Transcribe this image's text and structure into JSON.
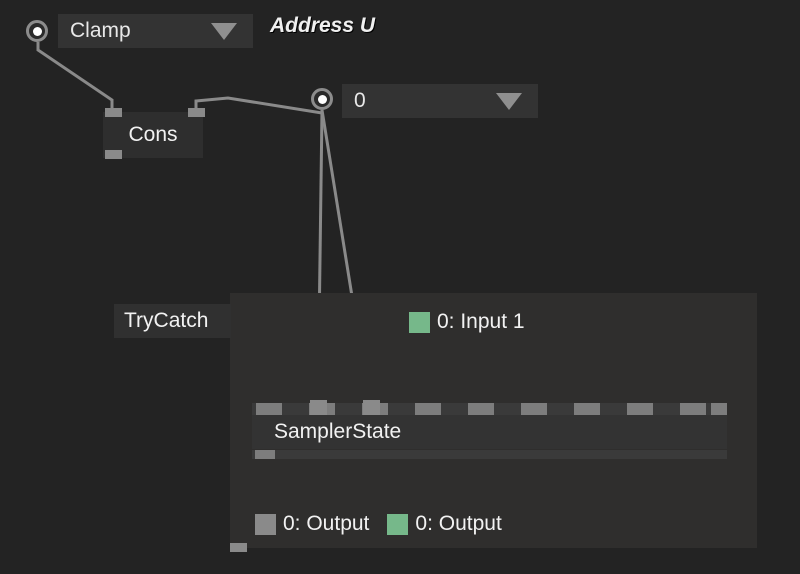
{
  "theme": {
    "background": "#232323",
    "panel": "#2f2e2d",
    "node": "#2e2e2e",
    "combo": "#333333",
    "wire": "#8a8a8a",
    "pin": "#8a8a8a",
    "text": "#f2f2f2",
    "port_green": "#76b88a",
    "port_gray": "#8a8a8a",
    "slot_bar": "#3a3a3a",
    "slot": "#7d7d7d"
  },
  "nodes": {
    "clamp_combo": {
      "value": "Clamp",
      "caret_icon": "chevron-down-icon",
      "radio_icon": "radio-pin-icon"
    },
    "address_u_label": "Address U",
    "index_combo": {
      "value": "0",
      "caret_icon": "chevron-down-icon",
      "radio_icon": "radio-pin-icon"
    },
    "cons_node": {
      "title": "Cons"
    },
    "trycatch_group": {
      "title": "TryCatch"
    },
    "sampler_state": {
      "title": "SamplerState",
      "slot_count": 11
    }
  },
  "ports": {
    "input_row": [
      {
        "index": "0",
        "label": "0:  Input 1",
        "color": "#76b88a"
      }
    ],
    "output_row": [
      {
        "index": "0",
        "label": "0:  Output",
        "color": "#8a8a8a"
      },
      {
        "index": "0",
        "label": "0:  Output",
        "color": "#76b88a"
      }
    ]
  }
}
